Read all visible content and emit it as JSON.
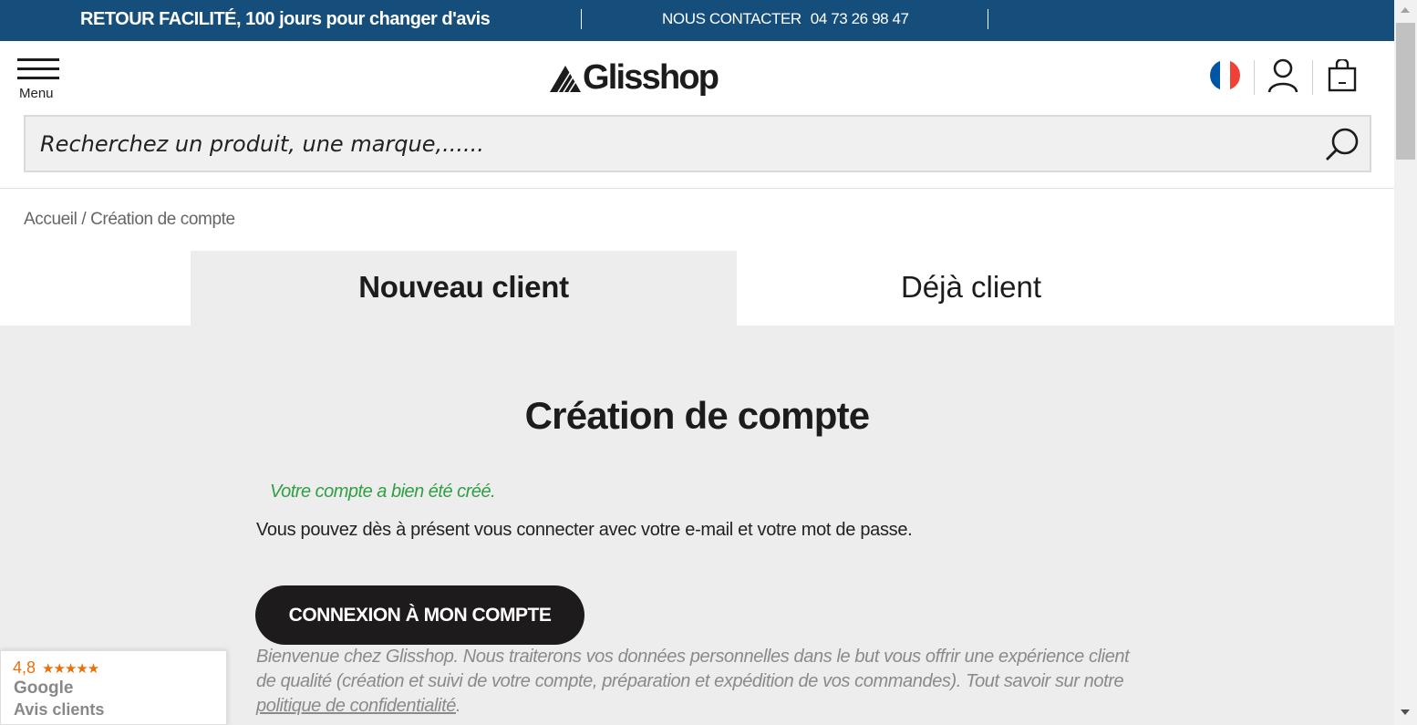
{
  "topbar": {
    "promo": "RETOUR FACILITÉ, 100 jours pour changer d'avis",
    "contact_label": "NOUS CONTACTER",
    "phone": "04 73 26 98 47"
  },
  "header": {
    "menu_label": "Menu",
    "logo_text": "Glisshop",
    "flag_colors": [
      "#0055a4",
      "#ffffff",
      "#ef4135"
    ]
  },
  "search": {
    "placeholder": "Recherchez un produit, une marque,......",
    "icon": "search-icon"
  },
  "breadcrumb": "Accueil / Création de compte",
  "tabs": [
    {
      "label": "Nouveau client",
      "active": true
    },
    {
      "label": "Déjà client",
      "active": false
    }
  ],
  "main": {
    "title": "Création de compte",
    "success": "Votre compte a bien été créé.",
    "info": "Vous pouvez dès à présent vous connecter avec votre e-mail et votre mot de passe.",
    "login_button": "CONNEXION À MON COMPTE",
    "privacy_text": "Bienvenue chez Glisshop. Nous traiterons vos données personnelles dans le but vous offrir une expérience client de qualité (création et suivi de votre compte, préparation et expédition de vos commandes). Tout savoir sur notre ",
    "privacy_link": "politique de confidentialité",
    "privacy_end": "."
  },
  "google_badge": {
    "rating": "4,8",
    "stars": "★★★★★",
    "brand": "Google",
    "label": "Avis clients"
  },
  "colors": {
    "topbar": "#154e7a",
    "panel": "#eeeded",
    "success": "#2f9e44",
    "button": "#1e1b1c",
    "rating": "#e8710a"
  }
}
